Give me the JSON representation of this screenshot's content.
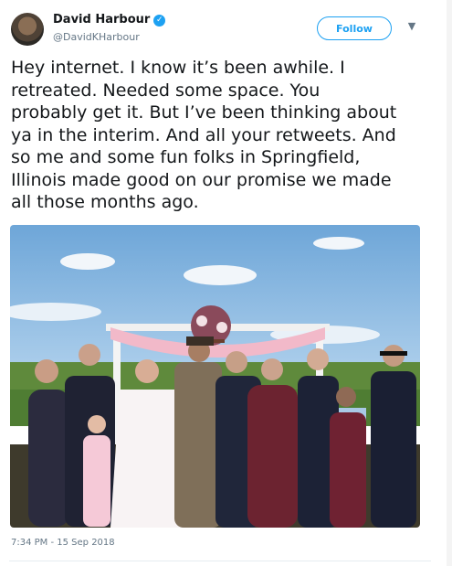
{
  "tweet": {
    "author_name": "David Harbour",
    "handle": "@DavidKHarbour",
    "follow_label": "Follow",
    "text": "Hey internet.  I know it’s been awhile.  I\nretreated.  Needed some space.  You\nprobably get it.  But I’ve been thinking about\nya in the interim.  And all your retweets.  And\nso me and some fun folks in Springfield,\nIllinois made good on our promise we made\nall those months ago.",
    "timestamp": "7:34 PM - 15 Sep 2018"
  },
  "icons": {
    "verified": "verified-badge-icon",
    "more": "chevron-down-icon"
  },
  "colors": {
    "accent": "#1da1f2",
    "text": "#14171a",
    "secondary": "#657786"
  }
}
